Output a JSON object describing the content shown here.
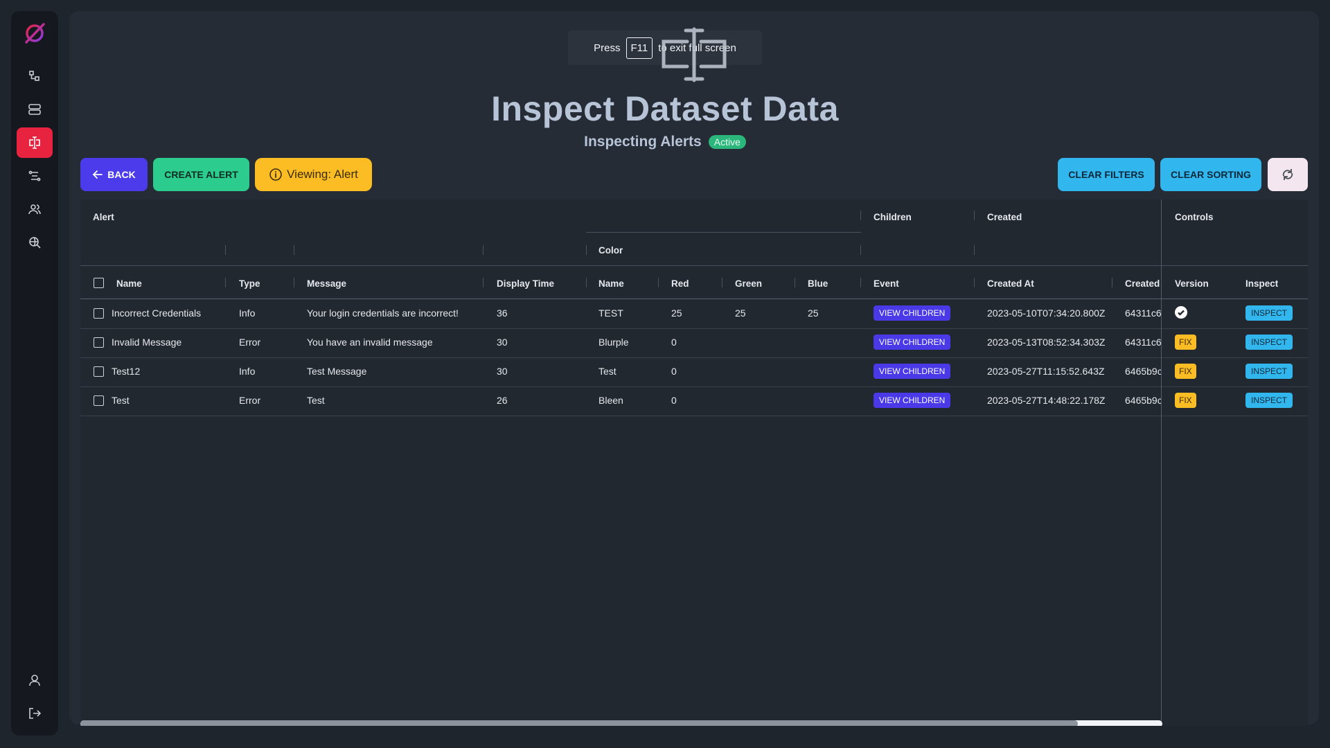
{
  "fullscreen_hint": {
    "prefix": "Press",
    "key": "F11",
    "suffix": "to exit full screen"
  },
  "header": {
    "title": "Inspect Dataset Data",
    "subtitle": "Inspecting Alerts",
    "status": "Active"
  },
  "toolbar": {
    "back_label": "BACK",
    "create_label": "CREATE ALERT",
    "viewing_label": "Viewing: Alert",
    "clear_filters_label": "CLEAR FILTERS",
    "clear_sorting_label": "CLEAR SORTING"
  },
  "sidebar": {
    "items": [
      {
        "icon": "hierarchy-icon"
      },
      {
        "icon": "database-icon"
      },
      {
        "icon": "inspect-icon",
        "active": true
      },
      {
        "icon": "flow-icon"
      },
      {
        "icon": "users-icon"
      },
      {
        "icon": "search-globe-icon"
      }
    ],
    "bottom": [
      {
        "icon": "profile-icon"
      },
      {
        "icon": "logout-icon"
      }
    ]
  },
  "table": {
    "groups": {
      "alert": "Alert",
      "color": "Color",
      "children": "Children",
      "created": "Created",
      "controls": "Controls"
    },
    "columns": {
      "name": "Name",
      "type": "Type",
      "message": "Message",
      "display_time": "Display Time",
      "color_name": "Name",
      "red": "Red",
      "green": "Green",
      "blue": "Blue",
      "event": "Event",
      "created_at": "Created At",
      "created_by": "Created",
      "version": "Version",
      "inspect": "Inspect"
    },
    "view_children_label": "VIEW CHILDREN",
    "inspect_label": "INSPECT",
    "fix_label": "FIX",
    "rows": [
      {
        "name": "Incorrect Credentials",
        "type": "Info",
        "message": "Your login credentials are incorrect!",
        "display_time": "36",
        "color_name": "TEST",
        "red": "25",
        "green": "25",
        "blue": "25",
        "created_at": "2023-05-10T07:34:20.800Z",
        "created_by": "64311c6",
        "version": "ok"
      },
      {
        "name": "Invalid Message",
        "type": "Error",
        "message": "You have an invalid message",
        "display_time": "30",
        "color_name": "Blurple",
        "red": "0",
        "green": "",
        "blue": "",
        "created_at": "2023-05-13T08:52:34.303Z",
        "created_by": "64311c6",
        "version": "fix"
      },
      {
        "name": "Test12",
        "type": "Info",
        "message": "Test Message",
        "display_time": "30",
        "color_name": "Test",
        "red": "0",
        "green": "",
        "blue": "",
        "created_at": "2023-05-27T11:15:52.643Z",
        "created_by": "6465b9c",
        "version": "fix"
      },
      {
        "name": "Test",
        "type": "Error",
        "message": "Test",
        "display_time": "26",
        "color_name": "Bleen",
        "red": "0",
        "green": "",
        "blue": "",
        "created_at": "2023-05-27T14:48:22.178Z",
        "created_by": "6465b9c",
        "version": "fix"
      }
    ]
  },
  "colors": {
    "accent_red": "#e8233f",
    "back": "#4c3bea",
    "create": "#2ccb8e",
    "viewing": "#fbbc24",
    "clear": "#31b6ee"
  }
}
